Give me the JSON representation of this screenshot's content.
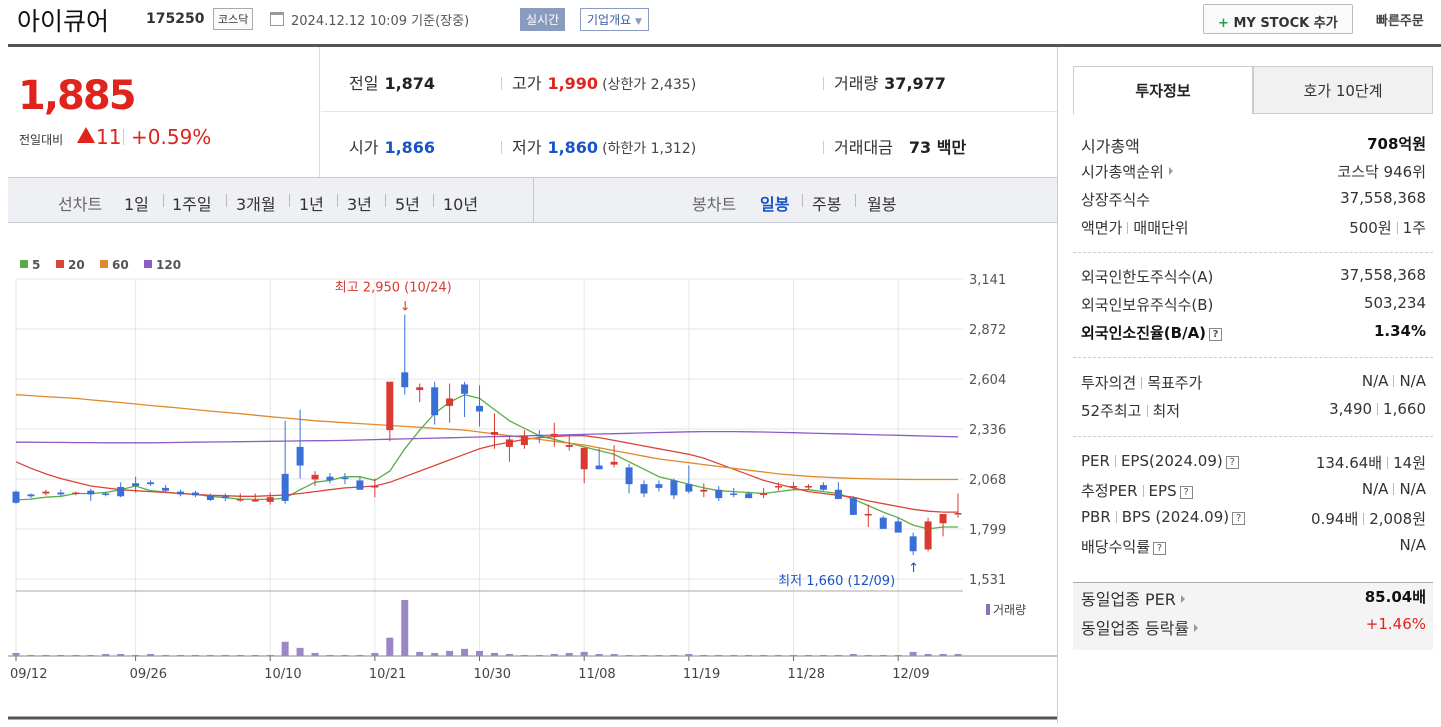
{
  "header": {
    "company": "아이큐어",
    "code": "175250",
    "market": "코스닥",
    "datetime": "2024.12.12 10:09  기준(장중)",
    "realtime": "실시간",
    "overview": "기업개요",
    "mystock": "MY STOCK 추가",
    "quick_order": "빠른주문"
  },
  "price": {
    "current": "1,885",
    "change_label": "전일대비",
    "change": "11",
    "change_pct": "+0.59%"
  },
  "quotes": {
    "prev_label": "전일",
    "prev": "1,874",
    "high_label": "고가",
    "high": "1,990",
    "upper": "(상한가 2,435)",
    "vol_label": "거래량",
    "vol": "37,977",
    "open_label": "시가",
    "open": "1,866",
    "low_label": "저가",
    "low": "1,860",
    "lower": "(하한가 1,312)",
    "amt_label": "거래대금",
    "amt": "73 백만"
  },
  "periods": {
    "line_label": "선차트",
    "line_items": [
      "1일",
      "1주일",
      "3개월",
      "1년",
      "3년",
      "5년",
      "10년"
    ],
    "candle_label": "봉차트",
    "candle_items": [
      "일봉",
      "주봉",
      "월봉"
    ],
    "candle_selected": "일봉"
  },
  "chart_data": {
    "type": "candlestick",
    "legend": [
      {
        "name": "5",
        "color": "#5aad45"
      },
      {
        "name": "20",
        "color": "#d9463a"
      },
      {
        "name": "60",
        "color": "#e08a2c"
      },
      {
        "name": "120",
        "color": "#8c5cc7"
      }
    ],
    "y_ticks": [
      "3,141",
      "2,872",
      "2,604",
      "2,336",
      "2,068",
      "1,799",
      "1,531"
    ],
    "ylim": [
      1531,
      3141
    ],
    "x_labels": [
      "09/12",
      "09/26",
      "10/10",
      "10/21",
      "10/30",
      "11/08",
      "11/19",
      "11/28",
      "12/09"
    ],
    "x_label_index": [
      0,
      8,
      17,
      24,
      31,
      38,
      45,
      52,
      59
    ],
    "high_annotation": "최고 2,950 (10/24)",
    "low_annotation": "최저 1,660 (12/09)",
    "volume_label": "거래량",
    "up_color": "#d93a32",
    "down_color": "#3b6fd8",
    "candles": [
      [
        2000,
        2005,
        1935,
        1940
      ],
      [
        1985,
        1990,
        1965,
        1975
      ],
      [
        1990,
        2010,
        1980,
        2000
      ],
      [
        1995,
        2010,
        1975,
        1985
      ],
      [
        1995,
        2000,
        1980,
        1995
      ],
      [
        2005,
        2015,
        1950,
        1985
      ],
      [
        1990,
        2000,
        1975,
        1985
      ],
      [
        2025,
        2050,
        1970,
        1975
      ],
      [
        2045,
        2080,
        1995,
        2030
      ],
      [
        2050,
        2060,
        2030,
        2040
      ],
      [
        2020,
        2035,
        1995,
        2005
      ],
      [
        2000,
        2010,
        1975,
        1985
      ],
      [
        1995,
        2005,
        1970,
        1980
      ],
      [
        1980,
        1990,
        1950,
        1955
      ],
      [
        1975,
        1990,
        1950,
        1965
      ],
      [
        1960,
        1990,
        1945,
        1960
      ],
      [
        1955,
        1990,
        1945,
        1955
      ],
      [
        1945,
        1995,
        1930,
        1970
      ],
      [
        2095,
        2380,
        1935,
        1950
      ],
      [
        2240,
        2440,
        2070,
        2140
      ],
      [
        2065,
        2110,
        2030,
        2090
      ],
      [
        2080,
        2100,
        2045,
        2060
      ],
      [
        2075,
        2100,
        2040,
        2070
      ],
      [
        2060,
        2080,
        2010,
        2010
      ],
      [
        2030,
        2070,
        1970,
        2030
      ],
      [
        2330,
        2580,
        2270,
        2590
      ],
      [
        2640,
        2950,
        2520,
        2560
      ],
      [
        2545,
        2580,
        2480,
        2560
      ],
      [
        2560,
        2590,
        2360,
        2410
      ],
      [
        2460,
        2580,
        2370,
        2500
      ],
      [
        2575,
        2590,
        2400,
        2525
      ],
      [
        2460,
        2570,
        2350,
        2430
      ],
      [
        2305,
        2420,
        2230,
        2320
      ],
      [
        2240,
        2300,
        2160,
        2280
      ],
      [
        2250,
        2330,
        2230,
        2300
      ],
      [
        2305,
        2330,
        2260,
        2300
      ],
      [
        2300,
        2370,
        2240,
        2310
      ],
      [
        2240,
        2300,
        2220,
        2250
      ],
      [
        2120,
        2210,
        2045,
        2235
      ],
      [
        2140,
        2230,
        2120,
        2120
      ],
      [
        2145,
        2250,
        2130,
        2160
      ],
      [
        2130,
        2150,
        1990,
        2040
      ],
      [
        2040,
        2060,
        1970,
        1990
      ],
      [
        2040,
        2060,
        2000,
        2020
      ],
      [
        2060,
        2070,
        1960,
        1980
      ],
      [
        2040,
        2140,
        1990,
        2000
      ],
      [
        2000,
        2045,
        1970,
        2010
      ],
      [
        2010,
        2030,
        1950,
        1965
      ],
      [
        1990,
        2020,
        1970,
        1985
      ],
      [
        1990,
        2000,
        1965,
        1965
      ],
      [
        1985,
        2020,
        1965,
        1990
      ],
      [
        2025,
        2050,
        2005,
        2030
      ],
      [
        2030,
        2050,
        2010,
        2030
      ],
      [
        2025,
        2040,
        2010,
        2030
      ],
      [
        2035,
        2050,
        2005,
        2010
      ],
      [
        2010,
        2050,
        1960,
        1960
      ],
      [
        1965,
        1975,
        1875,
        1875
      ],
      [
        1875,
        1930,
        1810,
        1880
      ],
      [
        1860,
        1870,
        1810,
        1800
      ],
      [
        1840,
        1860,
        1800,
        1780
      ],
      [
        1760,
        1780,
        1660,
        1680
      ],
      [
        1690,
        1860,
        1680,
        1840
      ],
      [
        1830,
        1870,
        1760,
        1880
      ],
      [
        1885,
        1990,
        1860,
        1885
      ]
    ],
    "ma": {
      "5": [
        1955,
        1960,
        1970,
        1975,
        1990,
        1990,
        1995,
        2010,
        2030,
        2005,
        1998,
        1990,
        1985,
        1975,
        1968,
        1960,
        1958,
        1958,
        1965,
        2010,
        2050,
        2060,
        2080,
        2080,
        2060,
        2110,
        2230,
        2330,
        2420,
        2480,
        2520,
        2500,
        2440,
        2380,
        2340,
        2300,
        2280,
        2260,
        2240,
        2220,
        2200,
        2160,
        2120,
        2080,
        2060,
        2040,
        2020,
        2005,
        2000,
        1995,
        1990,
        2000,
        2010,
        2010,
        2000,
        1990,
        1960,
        1925,
        1890,
        1860,
        1820,
        1800,
        1810,
        1810
      ],
      "20": [
        2160,
        2125,
        2095,
        2070,
        2050,
        2030,
        2020,
        2010,
        2005,
        2000,
        1995,
        1990,
        1985,
        1980,
        1978,
        1975,
        1975,
        1978,
        1982,
        1990,
        2000,
        2010,
        2020,
        2025,
        2030,
        2050,
        2080,
        2110,
        2140,
        2170,
        2200,
        2230,
        2250,
        2265,
        2280,
        2290,
        2295,
        2300,
        2300,
        2290,
        2275,
        2260,
        2245,
        2230,
        2215,
        2200,
        2180,
        2150,
        2120,
        2090,
        2060,
        2040,
        2020,
        2000,
        1990,
        1980,
        1970,
        1950,
        1935,
        1920,
        1905,
        1895,
        1890,
        1890
      ],
      "60": [
        2520,
        2515,
        2510,
        2505,
        2500,
        2492,
        2485,
        2478,
        2470,
        2462,
        2455,
        2448,
        2440,
        2432,
        2425,
        2418,
        2410,
        2402,
        2395,
        2388,
        2380,
        2375,
        2370,
        2365,
        2360,
        2355,
        2350,
        2345,
        2340,
        2335,
        2330,
        2320,
        2310,
        2300,
        2290,
        2280,
        2270,
        2260,
        2250,
        2235,
        2220,
        2205,
        2190,
        2175,
        2165,
        2155,
        2145,
        2135,
        2125,
        2115,
        2105,
        2095,
        2088,
        2082,
        2078,
        2074,
        2071,
        2069,
        2067,
        2066,
        2065,
        2065,
        2065,
        2065
      ],
      "120": [
        2265,
        2265,
        2264,
        2264,
        2263,
        2263,
        2262,
        2262,
        2262,
        2262,
        2263,
        2264,
        2265,
        2266,
        2267,
        2268,
        2269,
        2270,
        2271,
        2272,
        2273,
        2274,
        2275,
        2277,
        2279,
        2281,
        2283,
        2285,
        2287,
        2289,
        2291,
        2293,
        2295,
        2297,
        2299,
        2301,
        2303,
        2305,
        2307,
        2309,
        2311,
        2313,
        2315,
        2317,
        2319,
        2321,
        2322,
        2322,
        2322,
        2321,
        2320,
        2318,
        2316,
        2314,
        2312,
        2310,
        2308,
        2306,
        2304,
        2302,
        2300,
        2298,
        2296,
        2294
      ]
    },
    "volumes": [
      3,
      1,
      1,
      1,
      1,
      1,
      2,
      2,
      1,
      2,
      1,
      1,
      1,
      1,
      1,
      1,
      1,
      1,
      14,
      8,
      3,
      1,
      1,
      1,
      3,
      18,
      55,
      4,
      3,
      5,
      7,
      5,
      3,
      2,
      1,
      1,
      2,
      3,
      4,
      2,
      2,
      1,
      1,
      1,
      1,
      2,
      1,
      1,
      1,
      1,
      1,
      1,
      1,
      1,
      1,
      1,
      2,
      1,
      1,
      1,
      4,
      2,
      2,
      2
    ]
  },
  "panel": {
    "tab_invest": "투자정보",
    "tab_hoga": "호가 10단계",
    "market_cap_label": "시가총액",
    "market_cap": "708억원",
    "cap_rank_label": "시가총액순위",
    "cap_rank": "코스닥 946위",
    "shares_label": "상장주식수",
    "shares": "37,558,368",
    "par_label": "액면가",
    "unit_label": "매매단위",
    "par": "500원",
    "unit": "1주",
    "foreign_limit_label": "외국인한도주식수(A)",
    "foreign_limit": "37,558,368",
    "foreign_hold_label": "외국인보유주식수(B)",
    "foreign_hold": "503,234",
    "foreign_ratio_label": "외국인소진율(B/A)",
    "foreign_ratio": "1.34%",
    "opinion_label": "투자의견",
    "target_label": "목표주가",
    "opinion": "N/A",
    "target": "N/A",
    "w52_high_label": "52주최고",
    "w52_low_label": "최저",
    "w52_high": "3,490",
    "w52_low": "1,660",
    "per_label": "PER",
    "eps_label": "EPS(2024.09)",
    "per": "134.64배",
    "eps": "14원",
    "est_per_label": "추정PER",
    "est_eps_label": "EPS",
    "est_per": "N/A",
    "est_eps": "N/A",
    "pbr_label": "PBR",
    "bps_label": "BPS (2024.09)",
    "pbr": "0.94배",
    "bps": "2,008원",
    "div_label": "배당수익률",
    "div": "N/A",
    "sector_per_label": "동일업종 PER",
    "sector_per": "85.04배",
    "sector_chg_label": "동일업종 등락률",
    "sector_chg": "+1.46%"
  }
}
